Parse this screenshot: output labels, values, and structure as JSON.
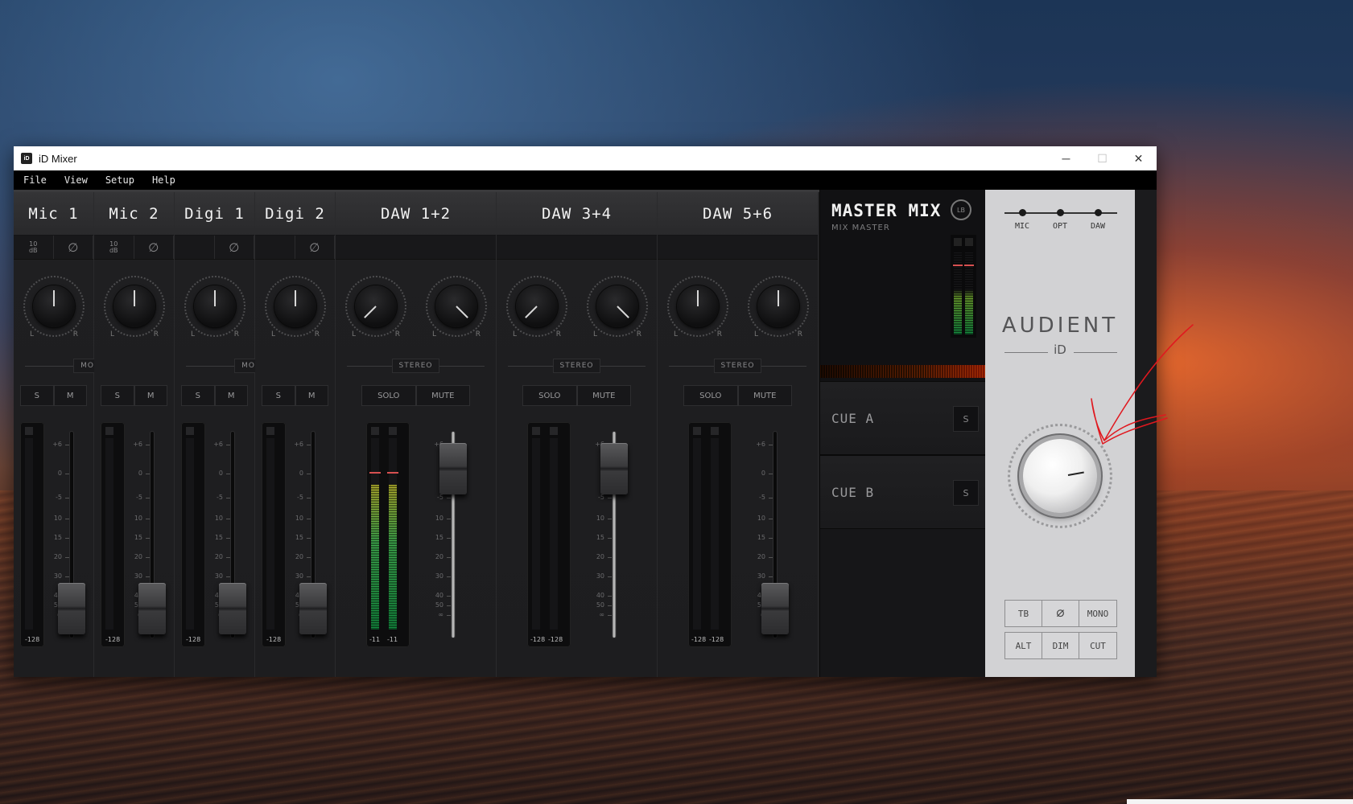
{
  "window": {
    "app_icon": "iD",
    "title": "iD Mixer",
    "controls": {
      "minimize": "─",
      "maximize": "☐",
      "close": "✕"
    }
  },
  "menu": [
    "File",
    "View",
    "Setup",
    "Help"
  ],
  "channels": [
    {
      "name": "Mic 1",
      "type": "mono",
      "pad": "10\ndB",
      "phase": "∅",
      "mode": "MONO",
      "btn_a": "S",
      "btn_b": "M",
      "pan_l": "L",
      "pan_r": "R",
      "meter_labels": [
        "-128"
      ],
      "fader_db": -60
    },
    {
      "name": "Mic 2",
      "type": "mono",
      "pad": "10\ndB",
      "phase": "∅",
      "btn_a": "S",
      "btn_b": "M",
      "pan_l": "L",
      "pan_r": "R",
      "meter_labels": [
        "-128"
      ],
      "fader_db": -60
    },
    {
      "name": "Digi 1",
      "type": "mono",
      "pad": "",
      "phase": "∅",
      "mode": "MONO",
      "btn_a": "S",
      "btn_b": "M",
      "pan_l": "L",
      "pan_r": "R",
      "meter_labels": [
        "-128"
      ],
      "fader_db": -60
    },
    {
      "name": "Digi 2",
      "type": "mono",
      "pad": "",
      "phase": "∅",
      "btn_a": "S",
      "btn_b": "M",
      "pan_l": "L",
      "pan_r": "R",
      "meter_labels": [
        "-128"
      ],
      "fader_db": -60
    },
    {
      "name": "DAW 1+2",
      "type": "stereo",
      "mode": "STEREO",
      "btn_a": "SOLO",
      "btn_b": "MUTE",
      "pan_l": "L",
      "pan_r": "R",
      "meter_labels": [
        "-11",
        "-11"
      ],
      "fader_db": 0
    },
    {
      "name": "DAW 3+4",
      "type": "stereo",
      "mode": "STEREO",
      "btn_a": "SOLO",
      "btn_b": "MUTE",
      "pan_l": "L",
      "pan_r": "R",
      "meter_labels": [
        "-128",
        "-128"
      ],
      "fader_db": 0
    },
    {
      "name": "DAW 5+6",
      "type": "stereo",
      "mode": "STEREO",
      "btn_a": "SOLO",
      "btn_b": "MUTE",
      "pan_l": "L",
      "pan_r": "R",
      "meter_labels": [
        "-128",
        "-128"
      ],
      "fader_db": -60
    }
  ],
  "scale_labels": [
    "+6",
    "0",
    "-5",
    "10",
    "15",
    "20",
    "30",
    "40",
    "50",
    "∞"
  ],
  "master": {
    "title": "MASTER MIX",
    "subtitle": "MIX MASTER",
    "lb_label": "LB",
    "cues": [
      {
        "name": "CUE A",
        "button": "S"
      },
      {
        "name": "CUE B",
        "button": "S"
      }
    ]
  },
  "device": {
    "sources": [
      "MIC",
      "OPT",
      "DAW"
    ],
    "brand": "AUDIENT",
    "brand_sub": "iD",
    "row1": [
      "TB",
      "∅",
      "MONO"
    ],
    "row2": [
      "ALT",
      "DIM",
      "CUT"
    ]
  },
  "colors": {
    "meter_green": "#2fa14a",
    "meter_red": "#d65050",
    "annotation": "#e0181f"
  }
}
